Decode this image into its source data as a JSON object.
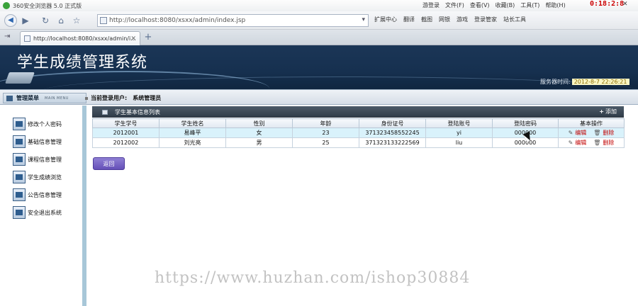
{
  "browser": {
    "title": "360安全浏览器 5.0 正式版",
    "menus": [
      "游登录",
      "文件(F)",
      "查看(V)",
      "收藏(B)",
      "工具(T)",
      "帮助(H)"
    ],
    "clock": "0:18:2:8",
    "url": "http://localhost:8080/xsxx/admin/index.jsp",
    "tools": [
      "扩展中心",
      "翻译",
      "截图",
      "网银",
      "游戏",
      "登录管家",
      "站长工具"
    ],
    "tab_label": "http://localhost:8080/xsxx/admin/i..."
  },
  "app": {
    "title": "学生成绩管理系统",
    "server_time_label": "服务器时间:",
    "server_time": "2012-8-7 22:26:21"
  },
  "subbar": {
    "menu_title": "管理菜单",
    "menu_title_en": "MAIN MENU",
    "login_label": "当前登录用户:",
    "login_user": "系统管理员"
  },
  "sidebar": {
    "items": [
      {
        "label": "修改个人密码"
      },
      {
        "label": "基础信息管理"
      },
      {
        "label": "课程信息管理"
      },
      {
        "label": "学生成绩浏览"
      },
      {
        "label": "公告信息管理"
      },
      {
        "label": "安全退出系统"
      }
    ]
  },
  "panel": {
    "title": "学生基本信息列表",
    "add_label": "添加",
    "columns": [
      "学生学号",
      "学生姓名",
      "性别",
      "年龄",
      "身份证号",
      "登陆账号",
      "登陆密码",
      "基本操作"
    ],
    "rows": [
      [
        "2012001",
        "易峰平",
        "女",
        "23",
        "371323458552245",
        "yi",
        "000000"
      ],
      [
        "2012002",
        "刘光亮",
        "男",
        "25",
        "371323133222569",
        "liu",
        "000000"
      ]
    ],
    "edit_label": "编辑",
    "delete_label": "删除",
    "back_label": "返回"
  },
  "watermark": "https://www.huzhan.com/ishop30884",
  "colors": {
    "header_bg": "#16304f",
    "highlight_row": "#d9f2fb",
    "action_red": "#c00000",
    "back_button": "#6550b8"
  }
}
